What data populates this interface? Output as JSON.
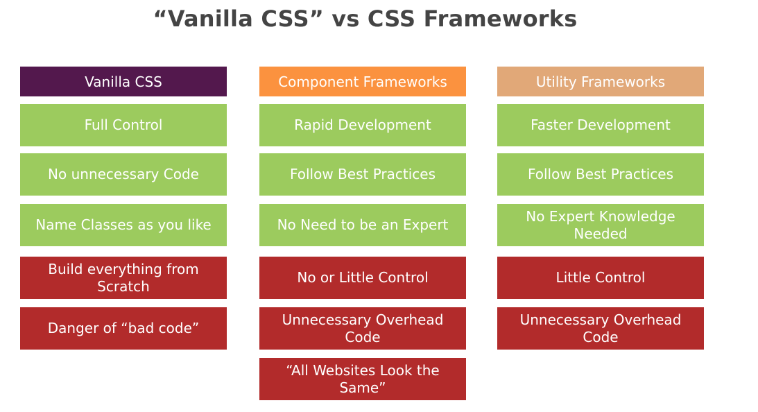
{
  "title": "“Vanilla CSS” vs CSS Frameworks",
  "colors": {
    "vanilla_header": "#53184d",
    "component_header": "#fb923f",
    "utility_header": "#e1a878",
    "pro": "#9ccb5e",
    "con": "#b22b2b",
    "title_text": "#444444"
  },
  "columns": [
    {
      "header": "Vanilla CSS",
      "items": [
        {
          "text": "Full Control",
          "kind": "pro"
        },
        {
          "text": "No unnecessary Code",
          "kind": "pro"
        },
        {
          "text": "Name Classes as you like",
          "kind": "pro"
        },
        {
          "text": "Build everything from Scratch",
          "kind": "con"
        },
        {
          "text": "Danger of “bad code”",
          "kind": "con"
        }
      ]
    },
    {
      "header": "Component Frameworks",
      "items": [
        {
          "text": "Rapid Development",
          "kind": "pro"
        },
        {
          "text": "Follow Best Practices",
          "kind": "pro"
        },
        {
          "text": "No Need to be an Expert",
          "kind": "pro"
        },
        {
          "text": "No or Little Control",
          "kind": "con"
        },
        {
          "text": "Unnecessary Overhead Code",
          "kind": "con"
        },
        {
          "text": "“All Websites Look the Same”",
          "kind": "con"
        }
      ]
    },
    {
      "header": "Utility Frameworks",
      "items": [
        {
          "text": "Faster Development",
          "kind": "pro"
        },
        {
          "text": "Follow Best Practices",
          "kind": "pro"
        },
        {
          "text": "No Expert Knowledge Needed",
          "kind": "pro"
        },
        {
          "text": "Little Control",
          "kind": "con"
        },
        {
          "text": "Unnecessary Overhead Code",
          "kind": "con"
        }
      ]
    }
  ]
}
